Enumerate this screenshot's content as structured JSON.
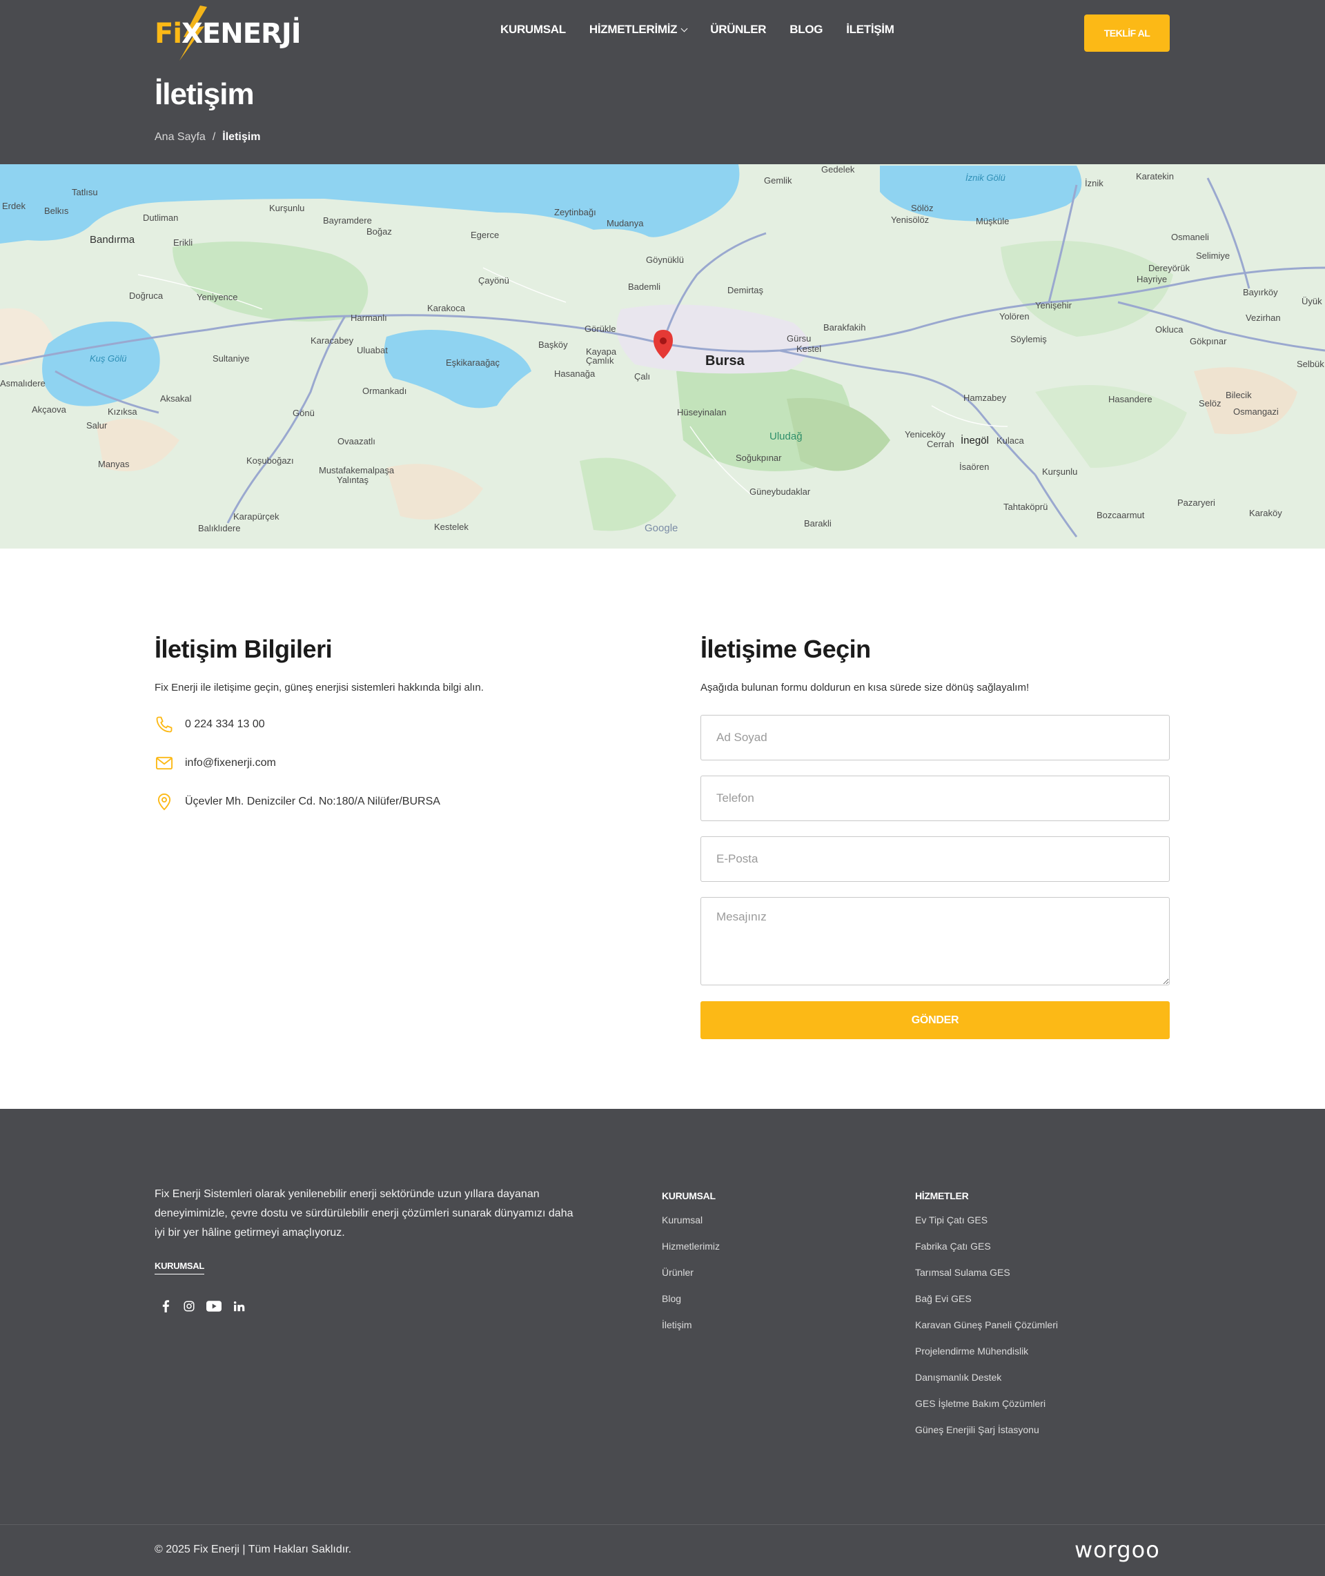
{
  "brand": {
    "logo_fi": "Fi",
    "logo_rest": "XENERJİ",
    "accent_color": "#fcb916",
    "dark_bg": "#4a4b4f"
  },
  "nav": {
    "items": [
      {
        "label": "KURUMSAL",
        "dropdown": false
      },
      {
        "label": "HİZMETLERİMİZ",
        "dropdown": true
      },
      {
        "label": "ÜRÜNLER",
        "dropdown": false
      },
      {
        "label": "BLOG",
        "dropdown": false
      },
      {
        "label": "İLETİŞİM",
        "dropdown": false
      }
    ],
    "cta": "TEKLİF AL"
  },
  "page": {
    "title": "İletişim",
    "breadcrumb": {
      "home": "Ana Sayfa",
      "sep": "/",
      "current": "İletişim"
    }
  },
  "map": {
    "city": "Bursa",
    "provider": "Google",
    "labels": [
      "Tatlısu",
      "Erdek",
      "Belkıs",
      "Dutliman",
      "Bandırma",
      "Kurşunlu",
      "Bayramdere",
      "Boğaz",
      "Zeytinbağı",
      "Mudanya",
      "Gemlik",
      "Gedelek",
      "İznik Gölü",
      "İznik",
      "Karatekin",
      "Erikli",
      "Egerce",
      "Sölöz",
      "Yenisölöz",
      "Müşküle",
      "Osmaneli",
      "Selimiye",
      "Doğruca",
      "Yeniyence",
      "Çayönü",
      "Göynüklü",
      "Dereyörük",
      "Hayriye",
      "Bayırköy",
      "Üyük",
      "Harmanlı",
      "Karakoca",
      "Bademli",
      "Demirtaş",
      "Yenişehir",
      "Yolören",
      "Vezirhan",
      "Kuş Gölü",
      "Karacabey",
      "Uluabat",
      "Eşkikaraağaç",
      "Görükle",
      "Başköy",
      "Kayapa",
      "Çamlık",
      "Gürsu",
      "Kestel",
      "Barakfakih",
      "Söylemiş",
      "Okluca",
      "Gökpınar",
      "Selbük",
      "Sultaniye",
      "Hasanağa",
      "Çalı",
      "Asmalıdere",
      "Ormankadı",
      "Akçaova",
      "Kızıksa",
      "Aksakal",
      "Gönü",
      "Hüseyinalan",
      "Hamzabey",
      "Hasandere",
      "Bilecik",
      "Selöz",
      "Osmangazi",
      "Salur",
      "Ovaazatlı",
      "Uludağ",
      "Yeniceköy",
      "Cerrah",
      "İnegöl",
      "Kulaca",
      "Manyas",
      "Koşuboğazı",
      "Mustafakemalpaşa",
      "Yalıntaş",
      "Soğukpınar",
      "İsaören",
      "Kurşunlu",
      "Güneybudaklar",
      "Tahtaköprü",
      "Pazaryeri",
      "Karaköy",
      "Karapürçek",
      "Bozcaarmut",
      "Balıklıdere",
      "Kestelek",
      "Barakli"
    ]
  },
  "contact_info": {
    "heading": "İletişim Bilgileri",
    "subtitle": "Fix Enerji ile iletişime geçin, güneş enerjisi sistemleri hakkında bilgi alın.",
    "phone": "0 224 334 13 00",
    "email": "info@fixenerji.com",
    "address": "Üçevler Mh. Denizciler Cd. No:180/A Nilüfer/BURSA"
  },
  "contact_form": {
    "heading": "İletişime Geçin",
    "subtitle": "Aşağıda bulunan formu doldurun en kısa sürede size dönüş sağlayalım!",
    "fields": {
      "name": {
        "placeholder": "Ad Soyad",
        "value": ""
      },
      "phone": {
        "placeholder": "Telefon",
        "value": ""
      },
      "email": {
        "placeholder": "E-Posta",
        "value": ""
      },
      "message": {
        "placeholder": "Mesajınız",
        "value": ""
      }
    },
    "submit": "GÖNDER"
  },
  "footer": {
    "about": "Fix Enerji Sistemleri olarak yenilenebilir enerji sektöründe uzun yıllara dayanan deneyimimizle, çevre dostu ve sürdürülebilir enerji çözümleri sunarak dünyamızı daha iyi bir yer hâline getirmeyi amaçlıyoruz.",
    "about_sub": "KURUMSAL",
    "socials": [
      "facebook-icon",
      "instagram-icon",
      "youtube-icon",
      "linkedin-icon"
    ],
    "col_corporate": {
      "title": "KURUMSAL",
      "links": [
        "Kurumsal",
        "Hizmetlerimiz",
        "Ürünler",
        "Blog",
        "İletişim"
      ]
    },
    "col_services": {
      "title": "HİZMETLER",
      "links": [
        "Ev Tipi Çatı GES",
        "Fabrika Çatı GES",
        "Tarımsal Sulama GES",
        "Bağ Evi GES",
        "Karavan Güneş Paneli Çözümleri",
        "Projelendirme Mühendislik",
        "Danışmanlık Destek",
        "GES İşletme Bakım Çözümleri",
        "Güneş Enerjili Şarj İstasyonu"
      ]
    },
    "copyright": "© 2025 Fix Enerji | Tüm Hakları Saklıdır.",
    "agency": "worgoo"
  }
}
